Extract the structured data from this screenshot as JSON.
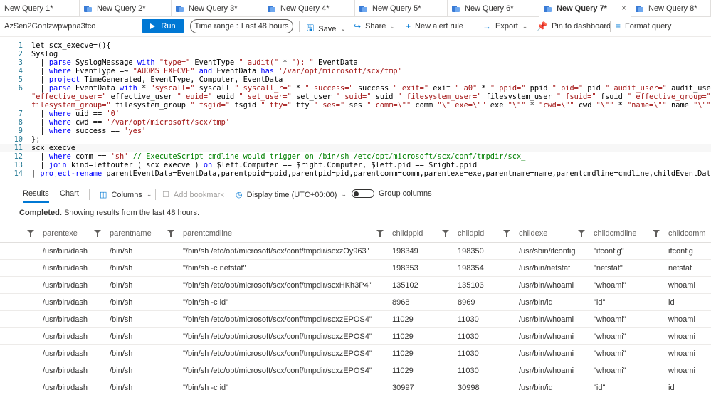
{
  "tabs": [
    {
      "label": "New Query 1*",
      "active": false
    },
    {
      "label": "New Query 2*",
      "active": false
    },
    {
      "label": "New Query 3*",
      "active": false
    },
    {
      "label": "New Query 4*",
      "active": false
    },
    {
      "label": "New Query 5*",
      "active": false
    },
    {
      "label": "New Query 6*",
      "active": false
    },
    {
      "label": "New Query 7*",
      "active": true
    },
    {
      "label": "New Query 8*",
      "active": false
    }
  ],
  "toolbar": {
    "workspace": "AzSen2Gonlzwpwpna3tco",
    "run_label": "Run",
    "time_range_label": "Time range :",
    "time_range_value": "Last 48 hours",
    "save_label": "Save",
    "share_label": "Share",
    "new_alert_label": "New alert rule",
    "export_label": "Export",
    "pin_label": "Pin to dashboard",
    "format_label": "Format query"
  },
  "editor": {
    "lines": [
      {
        "n": "1",
        "html": "let scx_execve=(){"
      },
      {
        "n": "2",
        "html": "Syslog"
      },
      {
        "n": "3",
        "html": "  | <span class=\"kw\">parse</span> SyslogMessage <span class=\"kw\">with</span> <span class=\"str\">\"type=\"</span> EventType <span class=\"str\">\" audit(\"</span> * <span class=\"str\">\"): \"</span> EventData"
      },
      {
        "n": "4",
        "html": "  | <span class=\"kw\">where</span> EventType =~ <span class=\"str\">\"AUOMS_EXECVE\"</span> <span class=\"kw\">and</span> EventData <span class=\"kw\">has</span> <span class=\"str\">'/var/opt/microsoft/scx/tmp'</span>"
      },
      {
        "n": "5",
        "html": "  | <span class=\"kw\">project</span> TimeGenerated, EventType, Computer, EventData"
      },
      {
        "n": "6",
        "html": "  | <span class=\"kw\">parse</span> EventData <span class=\"kw\">with</span> * <span class=\"str\">\"syscall=\"</span> syscall <span class=\"str\">\" syscall_r=\"</span> * <span class=\"str\">\" success=\"</span> success <span class=\"str\">\" exit=\"</span> exit <span class=\"str\">\" a0\"</span> * <span class=\"str\">\" ppid=\"</span> ppid <span class=\"str\">\" pid=\"</span> pid <span class=\"str\">\" audit_user=\"</span> audit_user <span class=\"str\">\" auid=\"</span>"
      },
      {
        "n": "",
        "html": "<span class=\"str\">\"effective_user=\"</span> effective_user <span class=\"str\">\" euid=\"</span> euid <span class=\"str\">\" set_user=\"</span> set_user <span class=\"str\">\" suid=\"</span> suid <span class=\"str\">\" filesystem_user=\"</span> filesystem_user <span class=\"str\">\" fsuid=\"</span> fsuid <span class=\"str\">\" effective_group=\"</span> effective_"
      },
      {
        "n": "",
        "html": "<span class=\"str\">filesystem_group=\"</span> filesystem_group <span class=\"str\">\" fsgid=\"</span> fsgid <span class=\"str\">\" tty=\"</span> tty <span class=\"str\">\" ses=\"</span> ses <span class=\"str\">\" comm=\\\"\"</span> comm <span class=\"str\">\"\\\" exe=\\\"\"</span> exe <span class=\"str\">\"\\\"\"</span> * <span class=\"str\">\"cwd=\\\"\"</span> cwd <span class=\"str\">\"\\\"\"</span> * <span class=\"str\">\"name=\\\"\"</span> name <span class=\"str\">\"\\\"\"</span> * <span class=\"str\">\"cmdline</span>"
      },
      {
        "n": "7",
        "html": "  | <span class=\"kw\">where</span> uid == <span class=\"str\">'0'</span>"
      },
      {
        "n": "8",
        "html": "  | <span class=\"kw\">where</span> cwd == <span class=\"str\">'/var/opt/microsoft/scx/tmp'</span>"
      },
      {
        "n": "9",
        "html": "  | <span class=\"kw\">where</span> success == <span class=\"str\">'yes'</span>"
      },
      {
        "n": "10",
        "html": "};"
      },
      {
        "n": "11",
        "html": "scx_execve"
      },
      {
        "n": "12",
        "html": "  | <span class=\"kw\">where</span> comm == <span class=\"str\">'sh'</span> <span class=\"cm\">// ExecuteScript cmdline would trigger on /bin/sh /etc/opt/microsoft/scx/conf/tmpdir/scx_</span>"
      },
      {
        "n": "13",
        "html": "  | <span class=\"kw\">join</span> kind=leftouter ( scx_execve ) <span class=\"kw\">on</span> $left.Computer == $right.Computer, $left.pid == $right.ppid"
      },
      {
        "n": "14",
        "html": "| <span class=\"kw\">project-rename</span> parentEventData=EventData,parentppid=ppid,parentpid=pid,parentcomm=comm,parentexe=exe,parentname=name,parentcmdline=cmdline,childEventData=EventData"
      }
    ]
  },
  "results": {
    "tab_results": "Results",
    "tab_chart": "Chart",
    "columns_label": "Columns",
    "add_bookmark_label": "Add bookmark",
    "display_time_label": "Display time (UTC+00:00)",
    "group_columns_label": "Group columns",
    "status_bold": "Completed.",
    "status_text": " Showing results from the last 48 hours."
  },
  "table": {
    "headers": [
      "parentexe",
      "parentname",
      "parentcmdline",
      "childppid",
      "childpid",
      "childexe",
      "childcmdline",
      "childcomm"
    ],
    "rows": [
      [
        "/usr/bin/dash",
        "/bin/sh",
        "\"/bin/sh /etc/opt/microsoft/scx/conf/tmpdir/scxzOy963\"",
        "198349",
        "198350",
        "/usr/sbin/ifconfig",
        "\"ifconfig\"",
        "ifconfig"
      ],
      [
        "/usr/bin/dash",
        "/bin/sh",
        "\"/bin/sh -c netstat\"",
        "198353",
        "198354",
        "/usr/bin/netstat",
        "\"netstat\"",
        "netstat"
      ],
      [
        "/usr/bin/dash",
        "/bin/sh",
        "\"/bin/sh /etc/opt/microsoft/scx/conf/tmpdir/scxHKh3P4\"",
        "135102",
        "135103",
        "/usr/bin/whoami",
        "\"whoami\"",
        "whoami"
      ],
      [
        "/usr/bin/dash",
        "/bin/sh",
        "\"/bin/sh -c id\"",
        "8968",
        "8969",
        "/usr/bin/id",
        "\"id\"",
        "id"
      ],
      [
        "/usr/bin/dash",
        "/bin/sh",
        "\"/bin/sh /etc/opt/microsoft/scx/conf/tmpdir/scxzEPOS4\"",
        "11029",
        "11030",
        "/usr/bin/whoami",
        "\"whoami\"",
        "whoami"
      ],
      [
        "/usr/bin/dash",
        "/bin/sh",
        "\"/bin/sh /etc/opt/microsoft/scx/conf/tmpdir/scxzEPOS4\"",
        "11029",
        "11030",
        "/usr/bin/whoami",
        "\"whoami\"",
        "whoami"
      ],
      [
        "/usr/bin/dash",
        "/bin/sh",
        "\"/bin/sh /etc/opt/microsoft/scx/conf/tmpdir/scxzEPOS4\"",
        "11029",
        "11030",
        "/usr/bin/whoami",
        "\"whoami\"",
        "whoami"
      ],
      [
        "/usr/bin/dash",
        "/bin/sh",
        "\"/bin/sh /etc/opt/microsoft/scx/conf/tmpdir/scxzEPOS4\"",
        "11029",
        "11030",
        "/usr/bin/whoami",
        "\"whoami\"",
        "whoami"
      ],
      [
        "/usr/bin/dash",
        "/bin/sh",
        "\"/bin/sh -c id\"",
        "30997",
        "30998",
        "/usr/bin/id",
        "\"id\"",
        "id"
      ]
    ]
  },
  "colors": {
    "accent": "#0078d4",
    "keyword": "#0000ff",
    "string": "#a31515",
    "comment": "#008000"
  }
}
